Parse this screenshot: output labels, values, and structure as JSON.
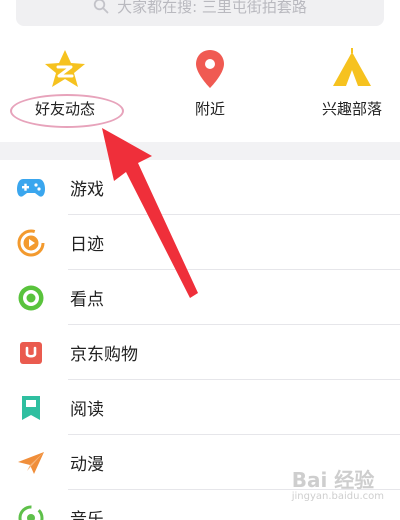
{
  "search": {
    "text": "大家都在搜: 三里屯街拍套路"
  },
  "shortcuts": [
    {
      "label": "好友动态",
      "icon": "qzone-star-icon"
    },
    {
      "label": "附近",
      "icon": "location-pin-icon"
    },
    {
      "label": "兴趣部落",
      "icon": "tent-icon"
    }
  ],
  "list": [
    {
      "label": "游戏",
      "icon": "gamepad-icon"
    },
    {
      "label": "日迹",
      "icon": "play-circle-icon"
    },
    {
      "label": "看点",
      "icon": "eye-ring-icon"
    },
    {
      "label": "京东购物",
      "icon": "jd-bag-icon"
    },
    {
      "label": "阅读",
      "icon": "book-icon"
    },
    {
      "label": "动漫",
      "icon": "paper-plane-icon"
    },
    {
      "label": "音乐",
      "icon": "music-icon"
    }
  ],
  "watermark": {
    "main": "Bai 经验",
    "sub": "jingyan.baidu.com"
  },
  "colors": {
    "star": "#f6c21f",
    "pin": "#f05a52",
    "tent": "#f6c21f",
    "game": "#3aa6ee",
    "diary": "#f39a2e",
    "eye": "#59c33c",
    "jd": "#ea5b4f",
    "book": "#2fbfa0",
    "plane": "#f08e3a",
    "music": "#5ec04a",
    "arrow": "#ef2f3a"
  }
}
